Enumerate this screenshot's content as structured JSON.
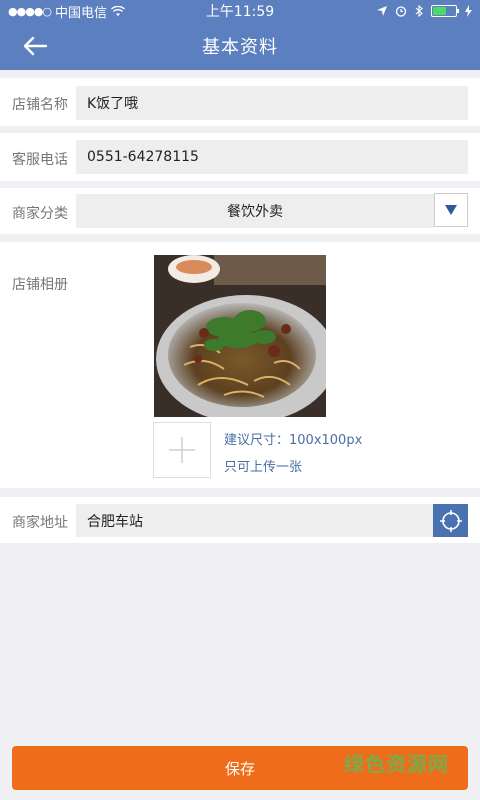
{
  "status_bar": {
    "signal_dots": "●●●●○",
    "carrier": "中国电信",
    "time": "上午11:59",
    "battery_level": 0.6
  },
  "nav": {
    "title": "基本资料"
  },
  "form": {
    "store_name": {
      "label": "店铺名称",
      "value": "K饭了哦"
    },
    "service_phone": {
      "label": "客服电话",
      "value": "0551-64278115"
    },
    "category": {
      "label": "商家分类",
      "value": "餐饮外卖"
    },
    "album": {
      "label": "店铺相册",
      "hint_size": "建议尺寸：100x100px",
      "hint_count": "只可上传一张"
    },
    "address": {
      "label": "商家地址",
      "value": "合肥车站"
    }
  },
  "save_label": "保存",
  "watermark": "绿色资源网",
  "colors": {
    "nav_bg": "#5b7fbf",
    "save_bg": "#ef6c1a",
    "hint_text": "#4a6fa5"
  }
}
